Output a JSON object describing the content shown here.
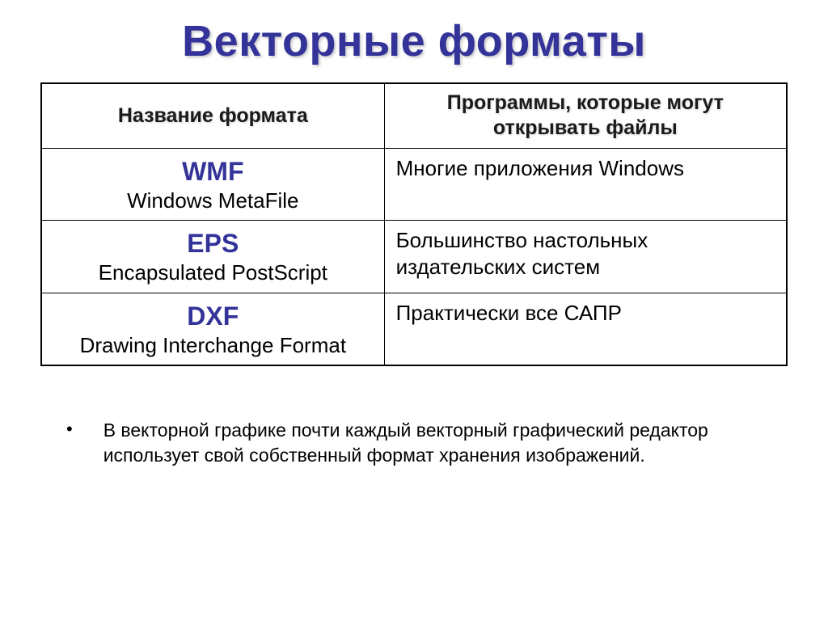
{
  "title": "Векторные форматы",
  "table": {
    "headers": {
      "name": "Название формата",
      "programs": "Программы, которые могут открывать файлы"
    },
    "rows": [
      {
        "abbr": "WMF",
        "fullname": "Windows MetaFile",
        "programs": "Многие приложения Windows"
      },
      {
        "abbr": "EPS",
        "fullname": "Encapsulated PostScript",
        "programs": "Большинство настольных издательских систем"
      },
      {
        "abbr": "DXF",
        "fullname": "Drawing Interchange Format",
        "programs": "Практически все САПР"
      }
    ]
  },
  "bullet": "•",
  "note": "В векторной графике почти каждый векторный графический редактор использует свой собственный формат хранения изображений."
}
